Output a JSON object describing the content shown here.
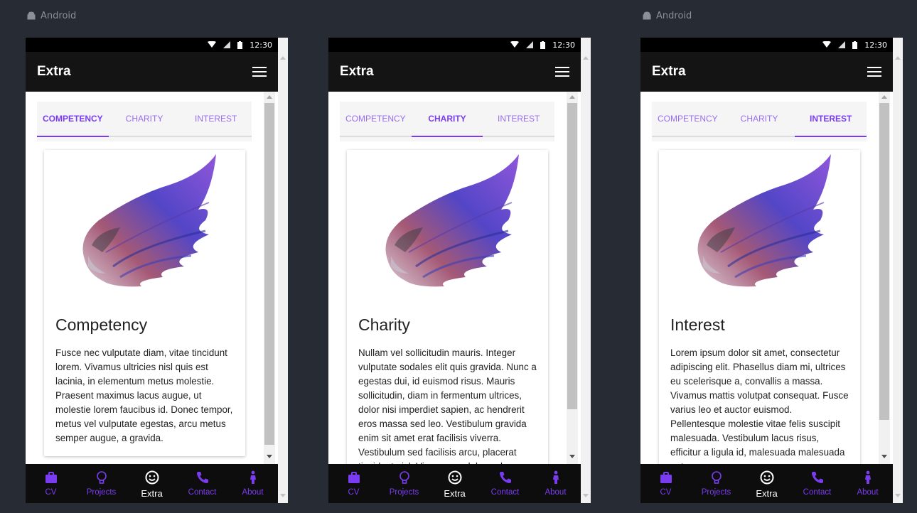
{
  "os_label": "Android",
  "status_time": "12:30",
  "appbar_title": "Extra",
  "tabs": [
    "COMPETENCY",
    "CHARITY",
    "INTEREST"
  ],
  "nav": [
    {
      "label": "CV",
      "icon": "briefcase-icon"
    },
    {
      "label": "Projects",
      "icon": "lightbulb-icon"
    },
    {
      "label": "Extra",
      "icon": "smiley-icon"
    },
    {
      "label": "Contact",
      "icon": "phone-icon"
    },
    {
      "label": "About",
      "icon": "person-icon"
    }
  ],
  "colors": {
    "accent": "#7a3cf0",
    "appbar": "#141414",
    "bottomnav": "#0d0d0d",
    "background": "#272b33"
  },
  "screens": [
    {
      "active_tab": 0,
      "card_title": "Competency",
      "card_text": "Fusce nec vulputate diam, vitae tincidunt lorem. Vivamus ultricies nisl quis est lacinia, in elementum metus molestie. Praesent maximus lacus augue, ut molestie lorem faucibus id. Donec tempor, metus vel vulputate egestas, arcu metus semper augue, a gravida."
    },
    {
      "active_tab": 1,
      "card_title": "Charity",
      "card_text": "Nullam vel sollicitudin mauris. Integer vulputate sodales elit quis gravida. Nunc a egestas dui, id euismod risus. Mauris sollicitudin, diam in fermentum ultrices, dolor nisi imperdiet sapien, ac hendrerit eros massa sed leo. Vestibulum gravida enim sit amet erat facilisis viverra. Vestibulum sed facilisis arcu, placerat tincidunt nisl. Vivamus sodales vel sem."
    },
    {
      "active_tab": 2,
      "card_title": "Interest",
      "card_text": "Lorem ipsum dolor sit amet, consectetur adipiscing elit. Phasellus diam mi, ultrices eu scelerisque a, convallis a massa. Vivamus mattis volutpat consequat. Fusce varius leo et auctor euismod. Pellentesque molestie vitae felis suscipit malesuada. Vestibulum lacus risus, efficitur a ligula id, malesuada malesuada ante."
    }
  ]
}
